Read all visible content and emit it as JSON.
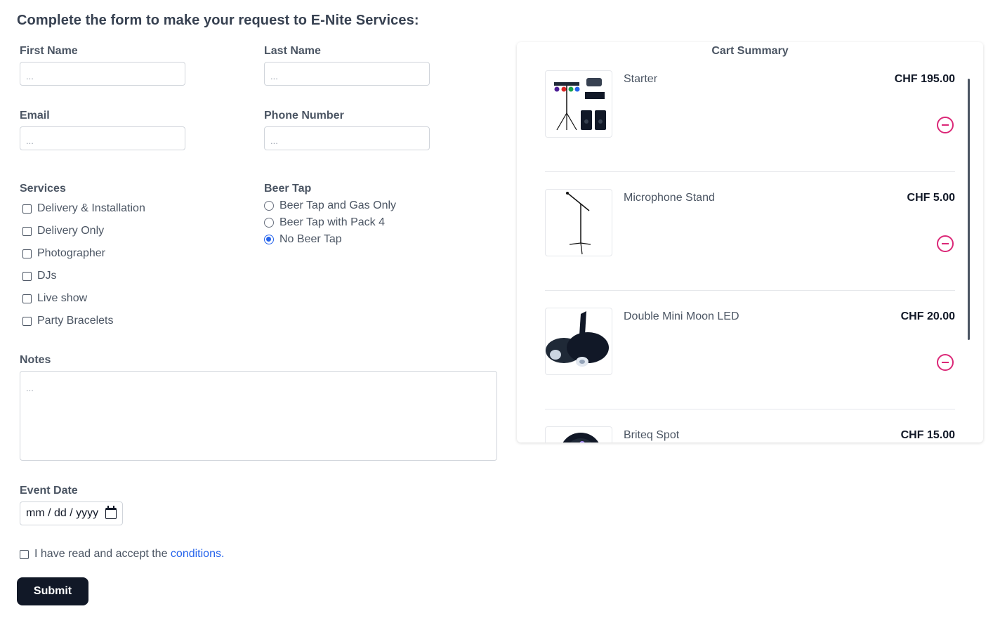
{
  "page": {
    "heading": "Complete the form to make your request to E-Nite Services:"
  },
  "form": {
    "first_name": {
      "label": "First Name",
      "placeholder": "..."
    },
    "last_name": {
      "label": "Last Name",
      "placeholder": "..."
    },
    "email": {
      "label": "Email",
      "placeholder": "..."
    },
    "phone": {
      "label": "Phone Number",
      "placeholder": "..."
    },
    "services": {
      "label": "Services",
      "options": [
        {
          "label": "Delivery & Installation",
          "checked": false
        },
        {
          "label": "Delivery Only",
          "checked": false
        },
        {
          "label": "Photographer",
          "checked": false
        },
        {
          "label": "DJs",
          "checked": false
        },
        {
          "label": "Live show",
          "checked": false
        },
        {
          "label": "Party Bracelets",
          "checked": false
        }
      ]
    },
    "beer_tap": {
      "label": "Beer Tap",
      "options": [
        {
          "label": "Beer Tap and Gas Only",
          "selected": false
        },
        {
          "label": "Beer Tap with Pack 4",
          "selected": false
        },
        {
          "label": "No Beer Tap",
          "selected": true
        }
      ]
    },
    "notes": {
      "label": "Notes",
      "placeholder": "..."
    },
    "event_date": {
      "label": "Event Date",
      "value": "mm / dd / yyyy",
      "icon": "calendar-icon"
    },
    "accept": {
      "text": "I have read and accept the ",
      "link_text": "conditions.",
      "checked": false
    },
    "submit_label": "Submit"
  },
  "cart": {
    "title": "Cart Summary",
    "items": [
      {
        "name": "Starter",
        "price": "CHF 195.00",
        "image": "dj-lighting-and-speaker-set"
      },
      {
        "name": "Microphone Stand",
        "price": "CHF 5.00",
        "image": "microphone-stand"
      },
      {
        "name": "Double Mini Moon LED",
        "price": "CHF 20.00",
        "image": "double-moon-led-light"
      },
      {
        "name": "Briteq Spot",
        "price": "CHF 15.00",
        "image": "led-par-spot"
      }
    ]
  },
  "colors": {
    "accent": "#2563eb",
    "remove": "#db2777",
    "button": "#111827"
  }
}
